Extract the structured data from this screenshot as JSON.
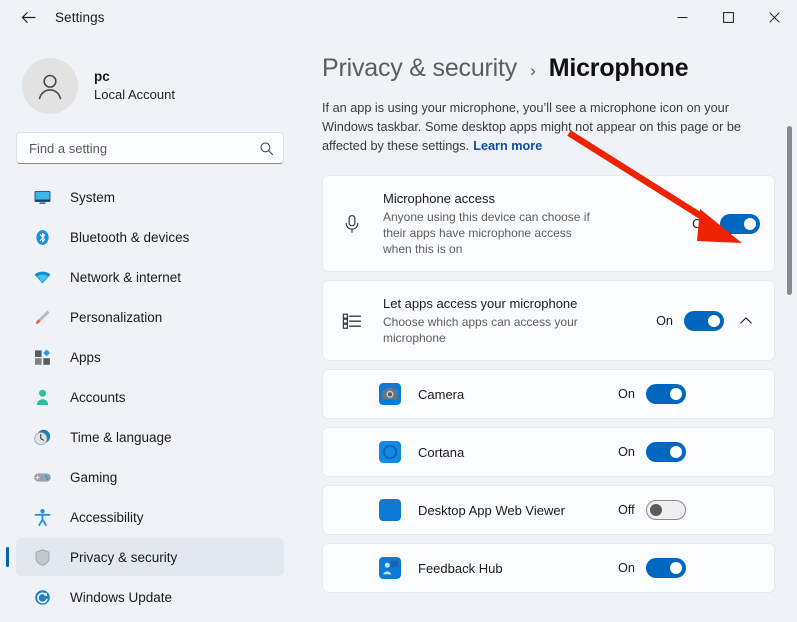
{
  "window": {
    "title": "Settings",
    "back_icon": "back-arrow-icon",
    "minimize_label": "–",
    "maximize_label": "□",
    "close_label": "✕"
  },
  "sidebar": {
    "account": {
      "name": "pc",
      "subtitle": "Local Account",
      "avatar_icon": "person-avatar-icon"
    },
    "search": {
      "placeholder": "Find a setting",
      "value": "",
      "icon": "search-icon"
    },
    "items": [
      {
        "label": "System",
        "icon": "system-monitor-icon",
        "active": false
      },
      {
        "label": "Bluetooth & devices",
        "icon": "bluetooth-icon",
        "active": false
      },
      {
        "label": "Network & internet",
        "icon": "wifi-icon",
        "active": false
      },
      {
        "label": "Personalization",
        "icon": "paintbrush-icon",
        "active": false
      },
      {
        "label": "Apps",
        "icon": "apps-grid-icon",
        "active": false
      },
      {
        "label": "Accounts",
        "icon": "account-person-icon",
        "active": false
      },
      {
        "label": "Time & language",
        "icon": "clock-globe-icon",
        "active": false
      },
      {
        "label": "Gaming",
        "icon": "gamepad-icon",
        "active": false
      },
      {
        "label": "Accessibility",
        "icon": "accessibility-icon",
        "active": false
      },
      {
        "label": "Privacy & security",
        "icon": "shield-icon",
        "active": true
      },
      {
        "label": "Windows Update",
        "icon": "windows-update-icon",
        "active": false
      }
    ]
  },
  "main": {
    "breadcrumb": {
      "parent": "Privacy & security",
      "separator": "›",
      "current": "Microphone"
    },
    "description": "If an app is using your microphone, you’ll see a microphone icon on your Windows taskbar. Some desktop apps might not appear on this page or be affected by these settings.",
    "learn_more": "Learn more",
    "cards": [
      {
        "title": "Microphone access",
        "subtitle": "Anyone using this device can choose if their apps have microphone access when this is on",
        "icon": "microphone-icon",
        "state_label": "On",
        "toggle_on": true,
        "has_chevron": false
      },
      {
        "title": "Let apps access your microphone",
        "subtitle": "Choose which apps can access your microphone",
        "icon": "app-list-icon",
        "state_label": "On",
        "toggle_on": true,
        "has_chevron": true,
        "chevron_icon": "chevron-up-icon"
      }
    ],
    "apps": [
      {
        "name": "Camera",
        "icon": "camera-app-icon",
        "state_label": "On",
        "toggle_on": true
      },
      {
        "name": "Cortana",
        "icon": "cortana-app-icon",
        "state_label": "On",
        "toggle_on": true
      },
      {
        "name": "Desktop App Web Viewer",
        "icon": "desktop-web-app-icon",
        "state_label": "Off",
        "toggle_on": false
      },
      {
        "name": "Feedback Hub",
        "icon": "feedback-hub-app-icon",
        "state_label": "On",
        "toggle_on": true
      }
    ]
  },
  "annotation": {
    "arrow_color": "#ee2200",
    "type": "red-arrow-pointing-to-microphone-access-toggle"
  },
  "colors": {
    "accent": "#0067c0",
    "selected_nav": "#e3e8ee",
    "nav_indicator": "#0063b1",
    "link": "#0f4da0",
    "page_bg": "#eff3f7",
    "card_bg": "#fbfcfe"
  }
}
